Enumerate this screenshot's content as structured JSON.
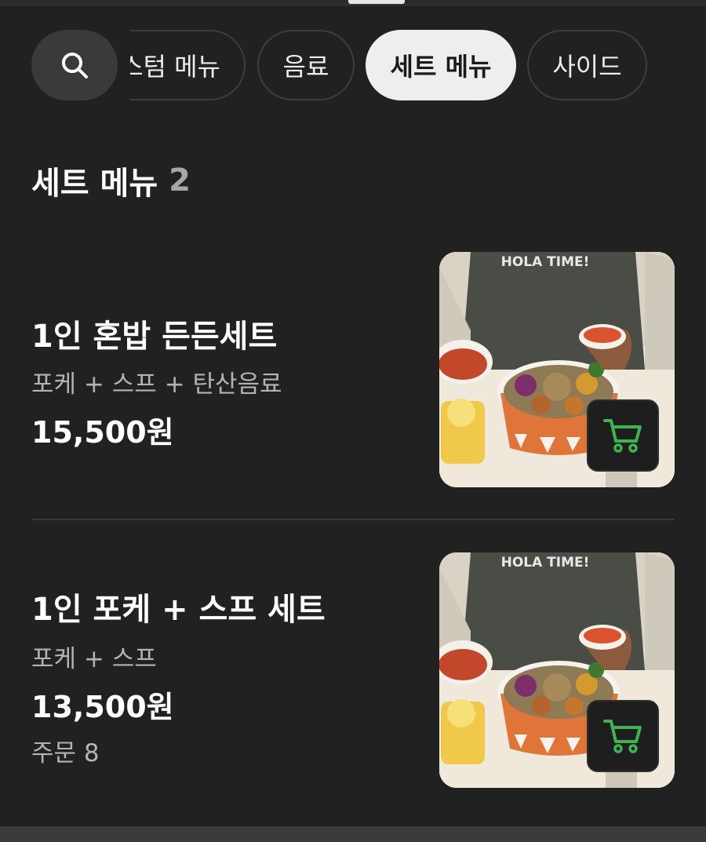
{
  "categories": {
    "search_icon": "search-icon",
    "items": [
      {
        "label": "스텀 메뉴",
        "active": false
      },
      {
        "label": "음료",
        "active": false
      },
      {
        "label": "세트 메뉴",
        "active": true
      },
      {
        "label": "사이드",
        "active": false
      }
    ]
  },
  "section": {
    "title": "세트 메뉴",
    "count": "2"
  },
  "menu_items": [
    {
      "name": "1인 혼밥 든든세트",
      "description": "포케 + 스프 + 탄산음료",
      "price": "15,500원",
      "image_text": "HOLA TIME!",
      "cart_icon": "cart-icon"
    },
    {
      "name": "1인 포케 + 스프 세트",
      "description": "포케 + 스프",
      "price": "13,500원",
      "orders": "주문 8",
      "image_text": "HOLA TIME!",
      "cart_icon": "cart-icon"
    }
  ],
  "colors": {
    "background": "#212121",
    "chip_active": "#eeeeee",
    "cart_green": "#3fb34f",
    "bowl_orange": "#e0753a"
  }
}
